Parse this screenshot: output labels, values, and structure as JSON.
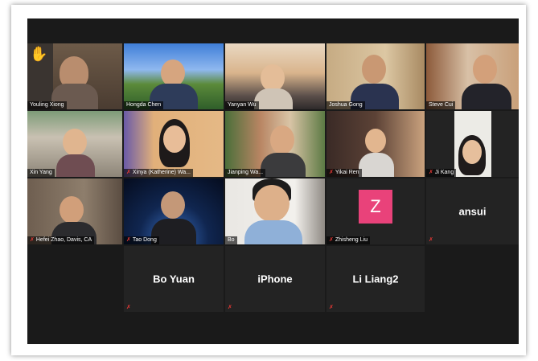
{
  "participants": {
    "youling": {
      "name": "Youling Xiong"
    },
    "hongda": {
      "name": "Hongda Chen"
    },
    "yanyan": {
      "name": "Yanyan Wu"
    },
    "joshua": {
      "name": "Joshua Gong"
    },
    "steve": {
      "name": "Steve Cui"
    },
    "xin": {
      "name": "Xin Yang"
    },
    "xinya": {
      "name": "Xinya (Katherine) Wa..."
    },
    "jianping": {
      "name": "Jianping Wa..."
    },
    "yikai": {
      "name": "Yikai Ren"
    },
    "jikang": {
      "name": "Ji Kang"
    },
    "hefei": {
      "name": "Hefei Zhao, Davis, CA"
    },
    "tao": {
      "name": "Tao Dong"
    },
    "bo": {
      "name": "Bo"
    },
    "zhisheng": {
      "name": "Zhisheng Liu",
      "avatar_letter": "Z"
    },
    "ansui": {
      "name": "ansui"
    },
    "boyuan": {
      "name": "Bo Yuan"
    },
    "iphone": {
      "name": "iPhone"
    },
    "liliang": {
      "name": "Li Liang2"
    }
  },
  "icons": {
    "hand": "raised-hand-icon",
    "mic": "mic-muted-icon"
  },
  "colors": {
    "active_speaker": "#a8d13a",
    "muted": "#e53935",
    "avatar_z": "#e9427a"
  }
}
